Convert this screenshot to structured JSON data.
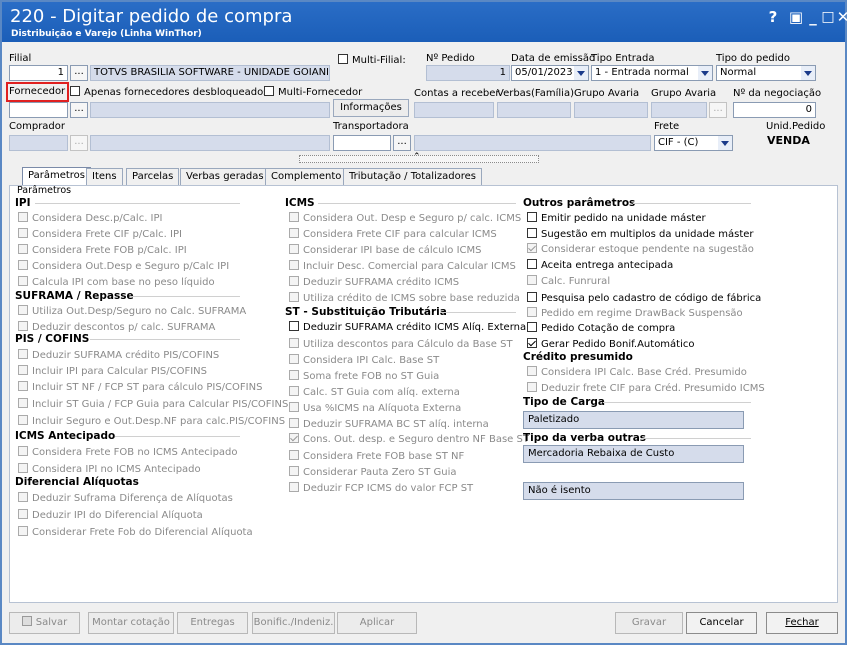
{
  "window": {
    "title": "220 - Digitar pedido de compra",
    "subtitle": "Distribuição e Varejo (Linha WinThor)",
    "controls": [
      "?",
      "▣",
      "_",
      "□",
      "✕"
    ]
  },
  "header": {
    "filial_label": "Filial",
    "filial_value": "1",
    "filial_name": "TOTVS BRASILIA SOFTWARE - UNIDADE GOIANI",
    "multi_filial_label": "Multi-Filial:",
    "num_pedido_label": "Nº Pedido",
    "num_pedido_value": "1",
    "data_emissao_label": "Data de emissão",
    "data_emissao_value": "05/01/2023",
    "tipo_entrada_label": "Tipo Entrada",
    "tipo_entrada_value": "1 - Entrada normal",
    "tipo_pedido_label": "Tipo do pedido",
    "tipo_pedido_value": "Normal",
    "fornecedor_label": "Fornecedor",
    "apenas_desbloq_label": "Apenas fornecedores desbloqueados",
    "multi_fornecedor_label": "Multi-Fornecedor",
    "informacoes_label": "Informações",
    "contas_receber_label": "Contas a receber",
    "verbas_familia_label": "Verbas(Família)",
    "grupo_avaria_label": "Grupo Avaria",
    "grupo_avaria2_label": "Grupo Avaria",
    "num_negociacao_label": "Nº da negociação",
    "num_negociacao_value": "0",
    "comprador_label": "Comprador",
    "transportadora_label": "Transportadora",
    "frete_label": "Frete",
    "frete_value": "CIF - (C)",
    "unid_pedido_label": "Unid.Pedido",
    "unid_pedido_value": "VENDA",
    "dots": "..."
  },
  "tabs": [
    {
      "label": "Parâmetros",
      "active": true
    },
    {
      "label": "Itens"
    },
    {
      "label": "Parcelas"
    },
    {
      "label": "Verbas geradas"
    },
    {
      "label": "Complemento"
    },
    {
      "label": "Tributação / Totalizadores"
    }
  ],
  "params_group_label": "Parâmetros",
  "col1": {
    "ipi_title": "IPI",
    "ipi": [
      "Considera Desc.p/Calc. IPI",
      "Considera Frete CIF p/Calc. IPI",
      "Considera Frete FOB p/Calc. IPI",
      "Considera Out.Desp e Seguro p/Calc IPI",
      "Calcula IPI com base no peso líquido"
    ],
    "suframa_title": "SUFRAMA / Repasse",
    "suframa": [
      "Utiliza Out.Desp/Seguro no Calc. SUFRAMA",
      "Deduzir descontos p/ calc. SUFRAMA"
    ],
    "pis_title": "PIS / COFINS",
    "pis": [
      "Deduzir SUFRAMA crédito PIS/COFINS",
      "Incluir IPI para Calcular PIS/COFINS",
      "Incluir ST NF / FCP ST para cálculo PIS/COFINS",
      "Incluir ST Guia / FCP Guia para Calcular PIS/COFINS",
      "Incluir Seguro e Out.Desp.NF para calc.PIS/COFINS"
    ],
    "icms_ant_title": "ICMS Antecipado",
    "icms_ant": [
      "Considera Frete FOB no ICMS Antecipado",
      "Considera IPI no ICMS Antecipado"
    ],
    "dif_title": "Diferencial Alíquotas",
    "dif": [
      "Deduzir Suframa Diferença de Alíquotas",
      "Deduzir IPI do Diferencial Alíquota",
      "Considerar Frete Fob do Diferencial Alíquota"
    ]
  },
  "col2": {
    "icms_title": "ICMS",
    "icms": [
      "Considera Out. Desp e Seguro p/ calc. ICMS",
      "Considera Frete CIF para calcular ICMS",
      "Considerar IPI base de cálculo ICMS",
      "Incluir Desc. Comercial  para Calcular ICMS",
      "Deduzir SUFRAMA crédito ICMS",
      "Utiliza crédito de ICMS sobre base reduzida"
    ],
    "st_title": "ST - Substituição Tributária",
    "st": [
      "Deduzir SUFRAMA crédito ICMS Alíq. Externa",
      "Utiliza descontos para Cálculo da Base ST",
      "Considera IPI Calc. Base ST",
      "Soma frete FOB no ST Guia",
      "Calc. ST Guia com alíq. externa",
      "Usa %ICMS na Alíquota Externa",
      "Deduzir SUFRAMA BC ST alíq. interna",
      "Cons. Out. desp. e Seguro dentro NF Base ST",
      "Considera Frete FOB base ST NF",
      "Considerar Pauta Zero ST Guia",
      "Deduzir FCP ICMS do valor FCP ST"
    ]
  },
  "col3": {
    "outros_title": "Outros parâmetros",
    "outros": [
      "Emitir pedido na unidade máster",
      "Sugestão em multiplos da unidade máster",
      "Considerar estoque pendente na sugestão",
      "Aceita entrega antecipada",
      "Calc. Funrural",
      "Pesquisa pelo cadastro de código de fábrica",
      "Pedido em regime DrawBack Suspensão",
      "Pedido Cotação de compra",
      "Gerar Pedido Bonif.Automático"
    ],
    "credito_title": "Crédito presumido",
    "credito": [
      "Considera IPI Calc. Base Créd. Presumido",
      "Deduzir frete CIF para Créd. Presumido ICMS"
    ],
    "carga_title": "Tipo de Carga",
    "carga_value": "Paletizado",
    "verba_title": "Tipo da verba outras",
    "verba_value": "Mercadoria Rebaixa de Custo",
    "isento_value": "Não é isento"
  },
  "footer": {
    "salvar": "Salvar",
    "montar": "Montar cotação",
    "entregas": "Entregas",
    "bonific": "Bonific./Indeniz.",
    "aplicar": "Aplicar",
    "gravar": "Gravar",
    "cancelar": "Cancelar",
    "fechar": "Fechar"
  },
  "colors": {
    "titlebar": "#1b5eb8",
    "highlight": "#e02020",
    "disabled_field": "#d5dceb"
  }
}
